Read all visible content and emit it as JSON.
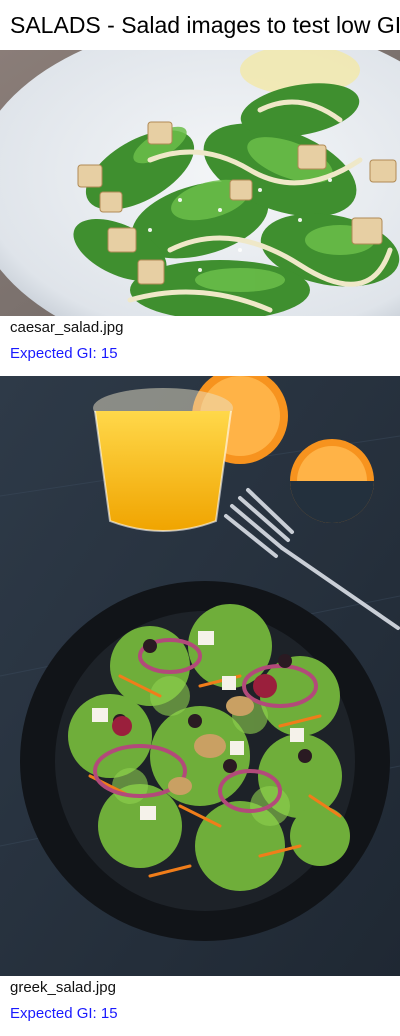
{
  "page": {
    "title": "SALADS - Salad images to test low GI"
  },
  "salads": [
    {
      "filename": "caesar_salad.jpg",
      "gi_label": "Expected GI: 15",
      "image_subject": "caesar salad on a white plate"
    },
    {
      "filename": "greek_salad.jpg",
      "gi_label": "Expected GI: 15",
      "image_subject": "greek salad in a dark bowl with orange juice, orange slices and a fork"
    }
  ],
  "colors": {
    "link_blue": "#1a1aff",
    "background": "#ffffff"
  }
}
